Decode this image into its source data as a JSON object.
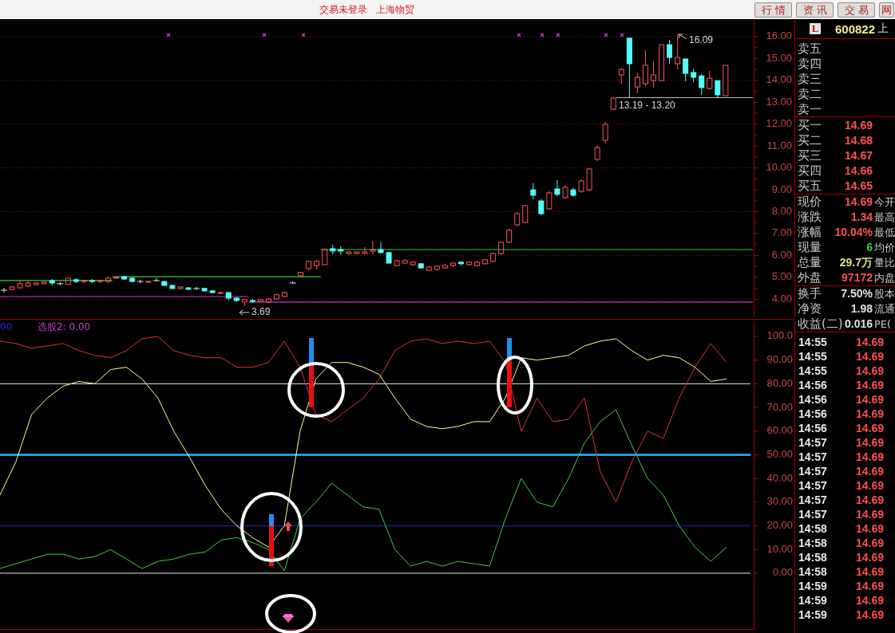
{
  "title_bar": {
    "status": "交易未登录",
    "security": "上海物贸",
    "buttons": [
      "行情",
      "资讯",
      "交易",
      "网"
    ]
  },
  "main_chart": {
    "chart_data": {
      "type": "candlestick",
      "grid": true,
      "ylim": [
        3.1,
        16.8
      ],
      "yticks": [
        {
          "value": 16,
          "label": "16.00"
        },
        {
          "value": 15,
          "label": "15.00"
        },
        {
          "value": 14,
          "label": "14.00"
        },
        {
          "value": 13,
          "label": "13.00"
        },
        {
          "value": 12,
          "label": "12.00"
        },
        {
          "value": 11,
          "label": "11.00"
        },
        {
          "value": 10,
          "label": "10.00"
        },
        {
          "value": 9,
          "label": "9.00"
        },
        {
          "value": 8,
          "label": "8.00"
        },
        {
          "value": 7,
          "label": "7.00"
        },
        {
          "value": 6,
          "label": "6.00"
        },
        {
          "value": 5,
          "label": "5.00"
        },
        {
          "value": 4,
          "label": "4.00"
        }
      ],
      "categories": [
        null,
        null,
        null,
        null,
        null,
        null,
        null,
        null,
        null,
        null,
        null,
        null,
        null,
        null,
        null,
        null,
        null,
        null,
        null,
        null,
        null,
        null,
        null,
        null,
        null,
        null,
        null,
        null,
        null,
        null,
        null,
        null,
        null,
        null,
        null,
        null,
        null,
        null,
        null,
        null,
        null,
        null,
        null,
        null,
        null,
        null,
        null,
        null,
        null,
        null,
        null,
        null,
        null,
        null,
        null,
        null,
        null,
        null,
        null,
        null,
        null,
        null,
        null,
        null,
        null,
        null,
        null,
        null,
        null,
        null,
        null,
        null,
        null,
        null,
        null,
        null,
        null,
        null,
        null,
        null,
        null,
        null,
        null,
        null,
        null,
        null,
        null,
        null,
        null,
        null,
        null,
        null,
        null,
        null
      ],
      "ohlc": [
        [
          4.41,
          4.52,
          4.3,
          4.41
        ],
        [
          4.45,
          4.6,
          4.41,
          4.56
        ],
        [
          4.52,
          4.85,
          4.49,
          4.71
        ],
        [
          4.6,
          4.81,
          4.56,
          4.74
        ],
        [
          4.67,
          4.78,
          4.63,
          4.74
        ],
        [
          4.71,
          4.81,
          4.67,
          4.78
        ],
        [
          4.85,
          4.92,
          4.63,
          4.74
        ],
        [
          4.71,
          4.78,
          4.63,
          4.71
        ],
        [
          4.67,
          4.96,
          4.67,
          4.96
        ],
        [
          4.89,
          4.96,
          4.74,
          4.81
        ],
        [
          4.81,
          4.89,
          4.74,
          4.85
        ],
        [
          4.85,
          4.92,
          4.74,
          4.81
        ],
        [
          4.81,
          4.89,
          4.74,
          4.85
        ],
        [
          4.81,
          5.03,
          4.74,
          4.96
        ],
        [
          4.96,
          5.07,
          4.92,
          5.0
        ],
        [
          5.03,
          5.07,
          4.89,
          4.92
        ],
        [
          4.96,
          5.0,
          4.78,
          4.81
        ],
        [
          4.81,
          4.89,
          4.74,
          4.81
        ],
        [
          4.78,
          4.85,
          4.74,
          4.81
        ],
        [
          4.85,
          4.96,
          4.81,
          4.85
        ],
        [
          4.81,
          4.85,
          4.6,
          4.63
        ],
        [
          4.63,
          4.67,
          4.45,
          4.49
        ],
        [
          4.49,
          4.6,
          4.45,
          4.56
        ],
        [
          4.52,
          4.56,
          4.41,
          4.45
        ],
        [
          4.49,
          4.56,
          4.41,
          4.49
        ],
        [
          4.49,
          4.52,
          4.34,
          4.38
        ],
        [
          4.38,
          4.41,
          4.27,
          4.3
        ],
        [
          4.27,
          4.34,
          4.23,
          4.3
        ],
        [
          4.3,
          4.34,
          3.94,
          4.05
        ],
        [
          4.05,
          4.09,
          3.87,
          3.94
        ],
        [
          3.87,
          4.01,
          3.69,
          3.98
        ],
        [
          3.94,
          4.01,
          3.83,
          3.9
        ],
        [
          3.9,
          4.01,
          3.87,
          3.98
        ],
        [
          3.87,
          4.05,
          3.83,
          4.01
        ],
        [
          4.01,
          4.23,
          3.98,
          4.2
        ],
        [
          4.12,
          4.34,
          4.09,
          4.3
        ],
        [
          4.74,
          4.81,
          4.71,
          4.74
        ],
        [
          5.07,
          5.25,
          5.0,
          5.22
        ],
        [
          5.4,
          5.76,
          5.29,
          5.73
        ],
        [
          5.54,
          5.8,
          5.36,
          5.73
        ],
        [
          5.58,
          6.31,
          5.58,
          6.27
        ],
        [
          6.31,
          6.49,
          6.05,
          6.2
        ],
        [
          6.27,
          6.42,
          6.02,
          6.2
        ],
        [
          6.09,
          6.2,
          6.02,
          6.16
        ],
        [
          6.09,
          6.16,
          6.05,
          6.16
        ],
        [
          6.09,
          6.38,
          6.05,
          6.16
        ],
        [
          6.2,
          6.67,
          6.05,
          6.27
        ],
        [
          6.27,
          6.6,
          6.09,
          6.13
        ],
        [
          6.13,
          6.16,
          5.62,
          5.65
        ],
        [
          5.54,
          5.8,
          5.51,
          5.76
        ],
        [
          5.65,
          5.83,
          5.62,
          5.76
        ],
        [
          5.58,
          5.73,
          5.51,
          5.69
        ],
        [
          5.62,
          5.65,
          5.4,
          5.43
        ],
        [
          5.32,
          5.51,
          5.29,
          5.47
        ],
        [
          5.36,
          5.54,
          5.32,
          5.51
        ],
        [
          5.43,
          5.62,
          5.4,
          5.54
        ],
        [
          5.54,
          5.69,
          5.47,
          5.65
        ],
        [
          5.69,
          5.73,
          5.54,
          5.62
        ],
        [
          5.58,
          5.73,
          5.54,
          5.69
        ],
        [
          5.54,
          5.76,
          5.51,
          5.69
        ],
        [
          5.62,
          5.83,
          5.58,
          5.8
        ],
        [
          5.73,
          6.13,
          5.69,
          6.09
        ],
        [
          6.09,
          6.64,
          6.05,
          6.6
        ],
        [
          6.6,
          7.22,
          6.56,
          7.15
        ],
        [
          7.4,
          7.98,
          7.33,
          7.91
        ],
        [
          7.51,
          8.31,
          7.47,
          8.28
        ],
        [
          9.0,
          9.3,
          8.57,
          8.75
        ],
        [
          8.49,
          8.57,
          7.84,
          7.91
        ],
        [
          8.13,
          8.93,
          8.09,
          8.86
        ],
        [
          9.04,
          9.44,
          8.71,
          8.79
        ],
        [
          8.64,
          9.22,
          8.57,
          9.11
        ],
        [
          9.0,
          9.08,
          8.68,
          8.75
        ],
        [
          8.93,
          9.48,
          8.86,
          9.4
        ],
        [
          9.0,
          10.02,
          8.93,
          9.95
        ],
        [
          10.39,
          11.04,
          10.32,
          10.93
        ],
        [
          11.26,
          12.1,
          11.12,
          11.99
        ],
        [
          12.68,
          13.23,
          12.65,
          13.19
        ],
        [
          14.25,
          14.58,
          13.85,
          14.5
        ],
        [
          15.93,
          15.93,
          13.19,
          14.76
        ],
        [
          13.7,
          14.36,
          13.41,
          14.14
        ],
        [
          13.85,
          15.38,
          13.74,
          14.69
        ],
        [
          13.99,
          14.87,
          13.67,
          14.25
        ],
        [
          13.99,
          15.63,
          13.99,
          15.63
        ],
        [
          15.63,
          15.85,
          14.76,
          15.05
        ],
        [
          14.76,
          16.09,
          14.5,
          15.05
        ],
        [
          14.98,
          14.98,
          13.96,
          14.32
        ],
        [
          14.36,
          14.54,
          13.92,
          14.14
        ],
        [
          14.21,
          14.29,
          13.34,
          13.67
        ],
        [
          13.63,
          14.43,
          13.56,
          14.1
        ],
        [
          13.99,
          13.99,
          13.2,
          13.34
        ],
        [
          13.3,
          14.69,
          13.27,
          14.69
        ],
        null,
        null,
        null
      ],
      "ref_lines": [
        {
          "axis": "y",
          "value": 4.85,
          "color": "#3cc83c"
        },
        {
          "axis": "y",
          "value": 5.03,
          "color": "#3cc83c"
        },
        {
          "axis": "y",
          "value": 6.27,
          "color": "#3cc83c"
        },
        {
          "axis": "y",
          "value": 4.12,
          "color": "#c83cc8"
        },
        {
          "axis": "y",
          "value": 3.87,
          "color": "#c83cc8"
        }
      ]
    },
    "high_label": "16.09",
    "range_label": "13.19 - 13.20",
    "low_label": "3.69"
  },
  "indicator": {
    "legend": [
      {
        "text": "00",
        "color": "#2828d8"
      },
      {
        "text": "选股2: 0.00",
        "color": "#c040d0"
      }
    ],
    "chart_data": {
      "type": "line",
      "ylim": [
        0,
        107.4
      ],
      "yticks": [
        {
          "value": 100,
          "label": "100.0"
        },
        {
          "value": 90,
          "label": "90.00"
        },
        {
          "value": 80,
          "label": "80.00"
        },
        {
          "value": 70,
          "label": "70.00"
        },
        {
          "value": 60,
          "label": "60.00"
        },
        {
          "value": 50,
          "label": "50.00"
        },
        {
          "value": 40,
          "label": "40.00"
        },
        {
          "value": 30,
          "label": "30.00"
        },
        {
          "value": 20,
          "label": "20.00"
        },
        {
          "value": 10,
          "label": "10.00"
        },
        {
          "value": 0,
          "label": "0.00"
        }
      ],
      "series": [
        {
          "color": "#e03030",
          "values": [
            98,
            97,
            95,
            96,
            97,
            94,
            92,
            91,
            94,
            99,
            100,
            94,
            92,
            91,
            91,
            87,
            87,
            89,
            98,
            87,
            67,
            64,
            69,
            74,
            82,
            94,
            98,
            99,
            97,
            98,
            97,
            98,
            89,
            60,
            74,
            64,
            65,
            74,
            43,
            30,
            47,
            60,
            57,
            74,
            87,
            97,
            89
          ]
        },
        {
          "color": "#ffff99",
          "values": [
            33,
            47,
            67,
            74,
            79,
            81,
            80,
            86,
            87,
            82,
            74,
            60,
            49,
            37,
            27,
            20,
            15,
            11,
            20,
            60,
            82,
            89,
            89,
            87,
            84,
            74,
            65,
            62,
            61,
            62,
            64,
            64,
            74,
            91,
            90,
            91,
            92,
            96,
            98,
            99,
            94,
            90,
            92,
            91,
            87,
            81,
            82
          ]
        },
        {
          "color": "#44cc44",
          "values": [
            2,
            4,
            6,
            8,
            8,
            6,
            7,
            10,
            6,
            2,
            5,
            6,
            8,
            9,
            14,
            15,
            13,
            10,
            1,
            23,
            30,
            38,
            33,
            28,
            27,
            10,
            3,
            5,
            3,
            5,
            4,
            3,
            23,
            40,
            30,
            28,
            40,
            55,
            64,
            69,
            54,
            40,
            33,
            20,
            11,
            5,
            11
          ]
        }
      ],
      "ref_lines": [
        {
          "axis": "y",
          "value": 80,
          "color": "#e8e8e8"
        },
        {
          "axis": "y",
          "value": 20,
          "color": "#2424c0"
        },
        {
          "axis": "y",
          "value": 0,
          "color": "#e8e8e8"
        }
      ],
      "bands": [
        {
          "axis": "y",
          "from": 49.5,
          "to": 50.5,
          "color": "#1e9be6"
        }
      ]
    }
  },
  "quote_panel": {
    "badge": "L",
    "code": "600822",
    "name": "上",
    "asks": [
      "卖五",
      "卖四",
      "卖三",
      "卖二",
      "卖一"
    ],
    "bids": [
      {
        "label": "买一",
        "price": "14.69"
      },
      {
        "label": "买二",
        "price": "14.68"
      },
      {
        "label": "买三",
        "price": "14.67"
      },
      {
        "label": "买四",
        "price": "14.66"
      },
      {
        "label": "买五",
        "price": "14.65"
      }
    ],
    "stats": [
      {
        "label": "现价",
        "value": "14.69",
        "color": "#ff5050",
        "label_2": "今开"
      },
      {
        "label": "涨跌",
        "value": "1.34",
        "color": "#ff5050",
        "label_2": "最高"
      },
      {
        "label": "涨幅",
        "value": "10.04%",
        "color": "#ff5050",
        "label_2": "最低"
      },
      {
        "label": "现量",
        "value": "6",
        "color": "#30d030",
        "label_2": "均价"
      },
      {
        "label": "总量",
        "value": "29.7万",
        "color": "#e0e080",
        "label_2": "量比"
      },
      {
        "label": "外盘",
        "value": "97172",
        "color": "#ff5050",
        "label_2": "内盘"
      }
    ],
    "finance": [
      {
        "label": "换手",
        "value": "7.50%",
        "label_2": "股本"
      },
      {
        "label": "净资",
        "value": "1.98",
        "label_2": "流通"
      },
      {
        "label": "收益(二)",
        "value": "0.016",
        "label_2": "PE("
      }
    ]
  },
  "ticks": [
    {
      "time": "14:55",
      "price": "14.69"
    },
    {
      "time": "14:55",
      "price": "14.69"
    },
    {
      "time": "14:55",
      "price": "14.69"
    },
    {
      "time": "14:56",
      "price": "14.69"
    },
    {
      "time": "14:56",
      "price": "14.69"
    },
    {
      "time": "14:56",
      "price": "14.69"
    },
    {
      "time": "14:56",
      "price": "14.69"
    },
    {
      "time": "14:57",
      "price": "14.69"
    },
    {
      "time": "14:57",
      "price": "14.69"
    },
    {
      "time": "14:57",
      "price": "14.69"
    },
    {
      "time": "14:57",
      "price": "14.69"
    },
    {
      "time": "14:57",
      "price": "14.69"
    },
    {
      "time": "14:57",
      "price": "14.69"
    },
    {
      "time": "14:58",
      "price": "14.69"
    },
    {
      "time": "14:58",
      "price": "14.69"
    },
    {
      "time": "14:58",
      "price": "14.69"
    },
    {
      "time": "14:58",
      "price": "14.69"
    },
    {
      "time": "14:59",
      "price": "14.69"
    },
    {
      "time": "14:59",
      "price": "14.69"
    },
    {
      "time": "14:59",
      "price": "14.69"
    }
  ]
}
